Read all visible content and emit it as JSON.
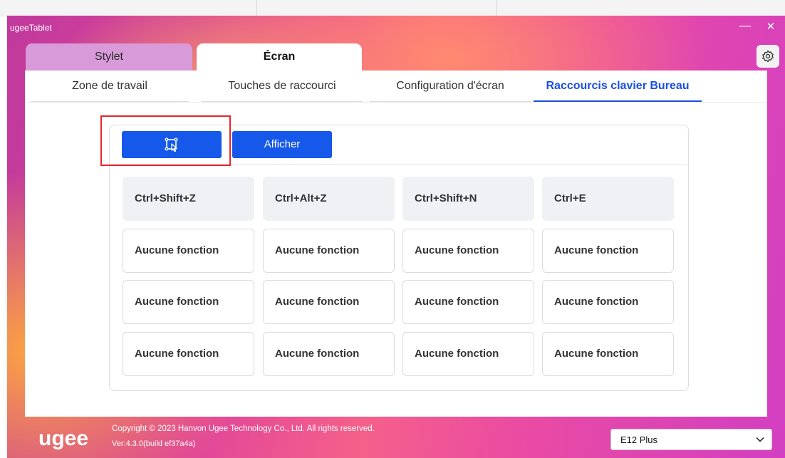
{
  "window": {
    "title": "ugeeTablet",
    "minimize_symbol": "—",
    "close_symbol": "✕"
  },
  "main_tabs": [
    {
      "label": "Stylet",
      "active": false
    },
    {
      "label": "Écran",
      "active": true
    }
  ],
  "settings": {
    "icon": "gear-icon"
  },
  "sub_tabs": [
    {
      "label": "Zone de travail",
      "active": false
    },
    {
      "label": "Touches de raccourci",
      "active": false
    },
    {
      "label": "Configuration d'écran",
      "active": false
    },
    {
      "label": "Raccourcis clavier Bureau",
      "active": true
    }
  ],
  "toolbar": {
    "icon_button": {
      "icon": "custom-region-icon"
    },
    "afficher_label": "Afficher"
  },
  "shortcut_grid": {
    "rows": [
      [
        "Ctrl+Shift+Z",
        "Ctrl+Alt+Z",
        "Ctrl+Shift+N",
        "Ctrl+E"
      ],
      [
        "Aucune fonction",
        "Aucune fonction",
        "Aucune fonction",
        "Aucune fonction"
      ],
      [
        "Aucune fonction",
        "Aucune fonction",
        "Aucune fonction",
        "Aucune fonction"
      ],
      [
        "Aucune fonction",
        "Aucune fonction",
        "Aucune fonction",
        "Aucune fonction"
      ]
    ]
  },
  "footer": {
    "logo_text": "ugee",
    "copyright": "Copyright © 2023 Hanvon Ugee Technology Co., Ltd. All rights reserved.",
    "version": "Ver:4.3.0(build ef37a4a)",
    "device_select_value": "E12 Plus"
  },
  "colors": {
    "accent": "#1558ea",
    "highlight": "#e6262d"
  }
}
